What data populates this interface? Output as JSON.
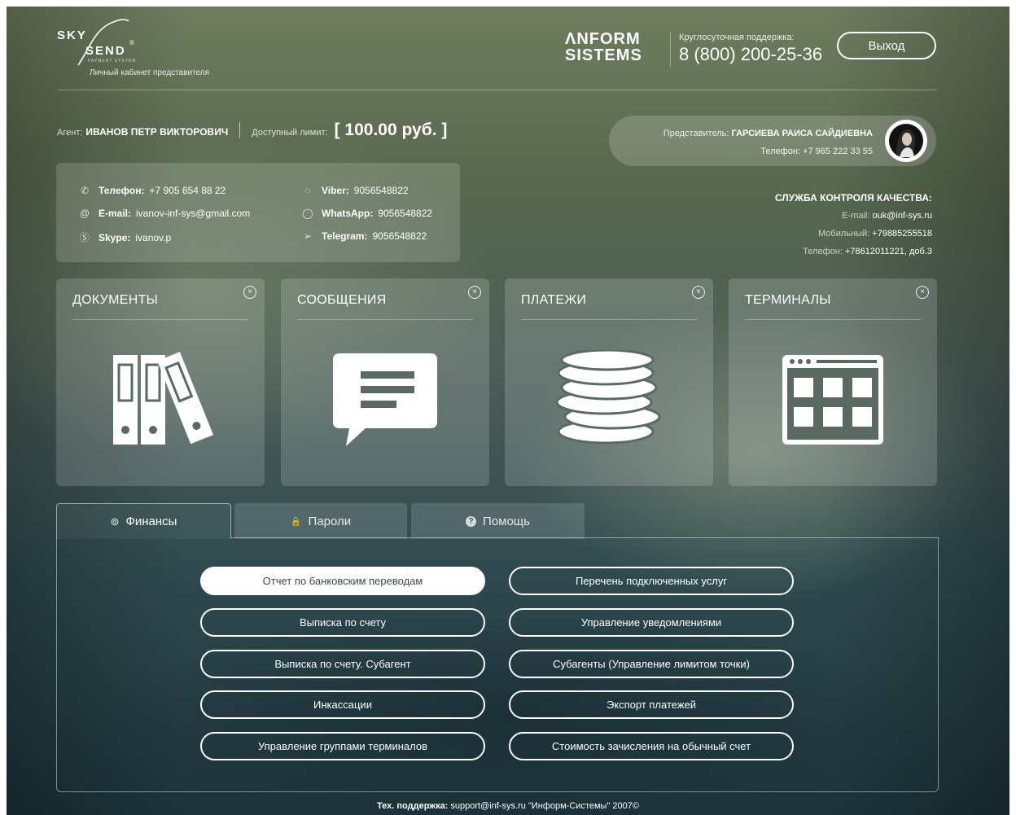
{
  "header": {
    "logo_sky": "SKY",
    "logo_send": "SEND",
    "logo_sub": "PAYMENT SYSTEM",
    "logo_tagline": "Личный кабинет представителя",
    "partner_line1": "ɅNFORM",
    "partner_line2": "SISTEMS",
    "support_label": "Круглосуточная поддержка:",
    "support_phone": "8 (800) 200-25-36",
    "logout_label": "Выход"
  },
  "agent": {
    "label": "Агент:",
    "name": "ИВАНОВ ПЕТР ВИКТОРОВИЧ",
    "limit_label": "Доступный лимит:",
    "limit_value": "[ 100.00 руб. ]"
  },
  "representative": {
    "label": "Представитель:",
    "name": "ГАРСИЕВА РАИСА САЙДИЕВНА",
    "phone_label": "Телефон:",
    "phone": "+7 965 222 33 55"
  },
  "contacts": {
    "phone_label": "Телефон:",
    "phone": "+7 905 654 88 22",
    "email_label": "E-mail:",
    "email": "ivanov-inf-sys@gmail.com",
    "skype_label": "Skype:",
    "skype": "ivanov.p",
    "viber_label": "Viber:",
    "viber": "9056548822",
    "whatsapp_label": "WhatsApp:",
    "whatsapp": "9056548822",
    "telegram_label": "Telegram:",
    "telegram": "9056548822"
  },
  "quality": {
    "title": "СЛУЖБА КОНТРОЛЯ КАЧЕСТВА:",
    "email_label": "E-mail:",
    "email": "ouk@inf-sys.ru",
    "mobile_label": "Мобильный:",
    "mobile": "+79885255518",
    "phone_label": "Телефон:",
    "phone": "+78612011221, доб.3"
  },
  "tiles": [
    {
      "title": "ДОКУМЕНТЫ",
      "icon": "binders-icon"
    },
    {
      "title": "СООБЩЕНИЯ",
      "icon": "message-icon"
    },
    {
      "title": "ПЛАТЕЖИ",
      "icon": "coins-icon"
    },
    {
      "title": "ТЕРМИНАЛЫ",
      "icon": "terminal-grid-icon"
    }
  ],
  "tiles_close_glyph": "×",
  "tabs": [
    {
      "label": "Финансы",
      "icon": "gear-icon",
      "glyph": "⊚",
      "active": true
    },
    {
      "label": "Пароли",
      "icon": "lock-icon",
      "glyph": "🔒",
      "active": false
    },
    {
      "label": "Помощь",
      "icon": "help-icon",
      "glyph": "?",
      "active": false
    }
  ],
  "finance_buttons_left": [
    "Отчет по банковским переводам",
    "Выписка по счету",
    "Выписка по счету. Субагент",
    "Инкассации",
    "Управление группами терминалов"
  ],
  "finance_buttons_right": [
    "Перечень подключенных услуг",
    "Управление уведомлениями",
    "Субагенты (Управление лимитом точки)",
    "Экспорт платежей",
    "Стоимость зачисления на обычный счет"
  ],
  "footer": {
    "label": "Тех. поддержка:",
    "text": "support@inf-sys.ru \"Информ-Системы\" 2007©"
  }
}
